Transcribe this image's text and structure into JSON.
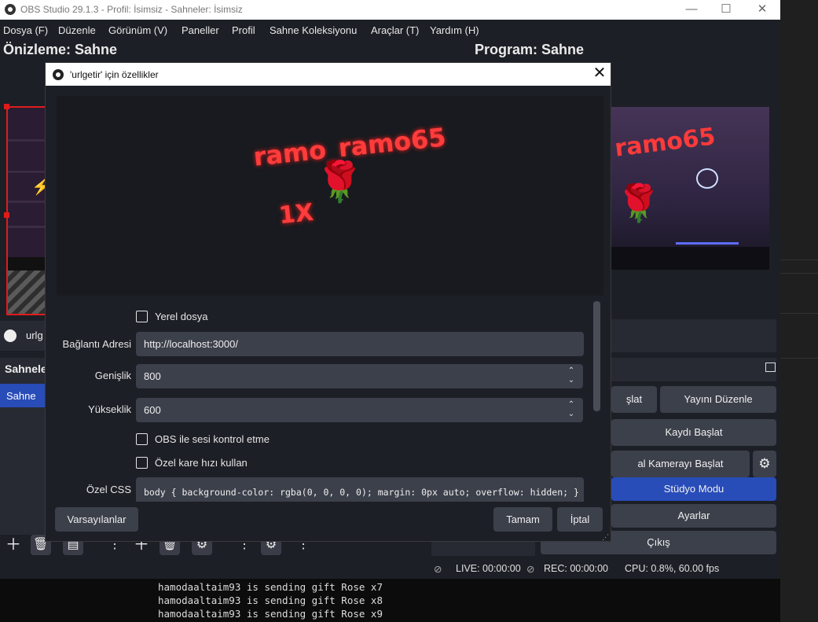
{
  "window": {
    "title": "OBS Studio 29.1.3 - Profil: İsimsiz - Sahneler: İsimsiz",
    "minimize": "—",
    "maximize": "☐",
    "close": "✕"
  },
  "menu": [
    "Dosya (F)",
    "Düzenle",
    "Görünüm (V)",
    "Paneller",
    "Profil",
    "Sahne Koleksiyonu",
    "Araçlar (T)",
    "Yardım (H)"
  ],
  "preview_title": "Önizleme: Sahne",
  "program_title": "Program: Sahne",
  "program_overlay": {
    "name": "ramo65"
  },
  "sources": {
    "item": "urlg"
  },
  "scenes": {
    "title": "Sahneler",
    "item": "Sahne"
  },
  "controls": {
    "start_stream": "şlat",
    "edit_stream": "Yayını Düzenle",
    "start_record": "Kaydı Başlat",
    "virtual_cam": "al Kamerayı Başlat",
    "studio_mode": "Stüdyo Modu",
    "settings": "Ayarlar",
    "exit": "Çıkış"
  },
  "status": {
    "live": "LIVE: 00:00:00",
    "rec": "REC: 00:00:00",
    "cpu": "CPU: 0.8%, 60.00 fps"
  },
  "dialog": {
    "title": "'urlgetir' için özellikler",
    "close": "✕",
    "preview": {
      "name": "ramo_ramo65",
      "multiplier": "1X",
      "rose": "🌹"
    },
    "local_file": "Yerel dosya",
    "url_label": "Bağlantı Adresi",
    "url_value": "http://localhost:3000/",
    "width_label": "Genişlik",
    "width_value": "800",
    "height_label": "Yükseklik",
    "height_value": "600",
    "audio_control": "OBS ile sesi kontrol etme",
    "custom_fps": "Özel kare hızı kullan",
    "css_label": "Özel CSS",
    "css_value": "body { background-color: rgba(0, 0, 0, 0); margin: 0px auto; overflow: hidden; }",
    "defaults": "Varsayılanlar",
    "ok": "Tamam",
    "cancel": "İptal"
  },
  "terminal": {
    "lines": [
      "hamodaaltaim93 is sending gift Rose x7",
      "hamodaaltaim93 is sending gift Rose x8",
      "hamodaaltaim93 is sending gift Rose x9"
    ]
  }
}
